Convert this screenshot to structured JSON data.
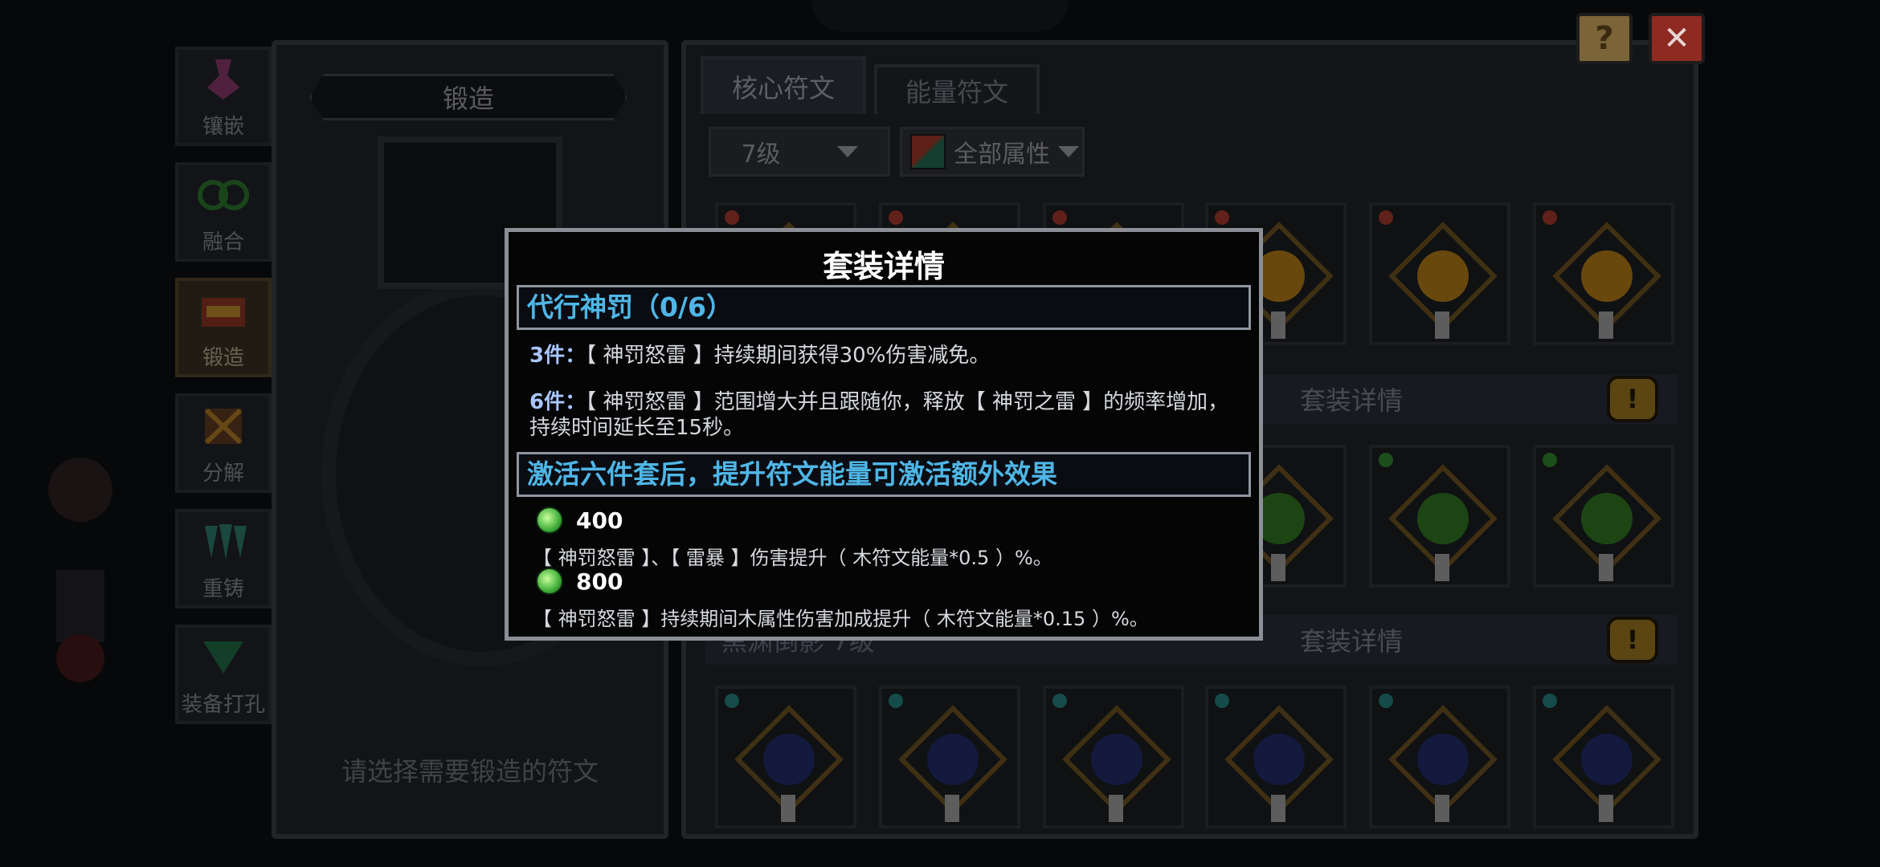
{
  "left_tabs": [
    {
      "label": "镶嵌",
      "icon": "inlay-icon",
      "active": false
    },
    {
      "label": "融合",
      "icon": "fusion-icon",
      "active": false
    },
    {
      "label": "锻造",
      "icon": "forge-icon",
      "active": true
    },
    {
      "label": "分解",
      "icon": "decompose-icon",
      "active": false
    },
    {
      "label": "重铸",
      "icon": "recast-icon",
      "active": false
    },
    {
      "label": "装备打孔",
      "icon": "socket-punch-icon",
      "active": false
    }
  ],
  "forge": {
    "title": "锻造",
    "hint": "请选择需要锻造的符文"
  },
  "rune_panel": {
    "tabs": [
      "核心符文",
      "能量符文"
    ],
    "level_filter": "7级",
    "attr_filter": "全部属性",
    "set_detail_label": "套装详情",
    "set_name_row3": "黑渊倒影 7级"
  },
  "corner_buttons": {
    "help": "?",
    "close": "✕"
  },
  "modal": {
    "title": "套装详情",
    "set_name": "代行神罚（0/6）",
    "effects": [
      {
        "key": "3件：",
        "text": "【 神罚怒雷 】持续期间获得30%伤害减免。"
      },
      {
        "key": "6件：",
        "text": "【 神罚怒雷 】范围增大并且跟随你，释放【 神罚之雷 】的频率增加，持续时间延长至15秒。"
      }
    ],
    "extra_header": "激活六件套后，提升符文能量可激活额外效果",
    "extras": [
      {
        "value": "400",
        "desc": "【 神罚怒雷 】、【 雷暴 】伤害提升（ 木符文能量*0.5 ）%。"
      },
      {
        "value": "800",
        "desc": "【 神罚怒雷 】持续期间木属性伤害加成提升（ 木符文能量*0.15 ）%。"
      }
    ]
  },
  "colors": {
    "accent_blue": "#4fb6e6",
    "fire_gem": "#d64a3a",
    "wood_gem": "#3fae3a",
    "dark_gem": "#2fa7a0"
  }
}
